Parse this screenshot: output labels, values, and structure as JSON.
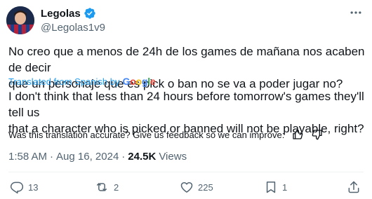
{
  "author": {
    "display_name": "Legolas",
    "handle": "@Legolas1v9",
    "verified": true
  },
  "tweet": {
    "original_text": "No creo que a menos de 24h de los games de mañana nos acaben de decir\nque un personaje que es pick o ban no se va a poder jugar no?",
    "translated_from": "Translated from Spanish by",
    "translator": "Google",
    "translation_text": "I don't think that less than 24 hours before tomorrow's games they'll tell us\nthat a character who is picked or banned will not be playable, right?",
    "feedback_prompt": "Was this translation accurate? Give us feedback so we can improve:"
  },
  "meta": {
    "time": "1:58 AM",
    "separator": "·",
    "date": "Aug 16, 2024",
    "views_count": "24.5K",
    "views_label": "Views"
  },
  "actions": {
    "replies": "13",
    "reposts": "2",
    "likes": "225",
    "bookmarks": "1"
  },
  "icons": {
    "more": "more-icon",
    "verified": "verified-badge-icon",
    "thumbs_up": "thumbs-up-icon",
    "thumbs_down": "thumbs-down-icon",
    "reply": "reply-icon",
    "repost": "repost-icon",
    "like": "heart-icon",
    "bookmark": "bookmark-icon",
    "share": "share-icon"
  },
  "colors": {
    "accent": "#1d9bf0",
    "text": "#0f1419",
    "secondary": "#536471"
  }
}
